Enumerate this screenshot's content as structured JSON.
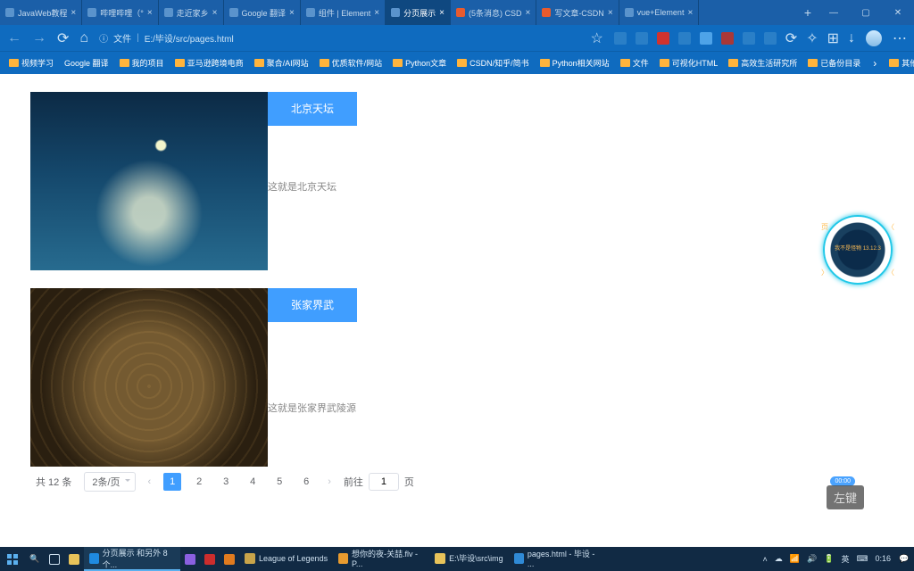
{
  "browser_tabs": [
    {
      "label": "JavaWeb教程"
    },
    {
      "label": "哔哩哔哩（°"
    },
    {
      "label": "走近家乡"
    },
    {
      "label": "Google 翻译"
    },
    {
      "label": "组件 | Element"
    },
    {
      "label": "分页展示"
    },
    {
      "label": "(5条消息) CSD"
    },
    {
      "label": "写文章-CSDN"
    },
    {
      "label": "vue+Element"
    }
  ],
  "active_tab_index": 5,
  "window_controls": {
    "min": "—",
    "max": "▢",
    "close": "✕"
  },
  "address": {
    "file_label": "文件",
    "path": "E:/毕设/src/pages.html"
  },
  "addr_icons": [
    "star",
    "ext1",
    "shield",
    "tri",
    "x",
    "n",
    "ia",
    "ext2",
    "ext3",
    "pin",
    "refresh",
    "reader",
    "download"
  ],
  "bookmarks": [
    "视频学习",
    "Google 翻译",
    "我的项目",
    "亚马逊跨境电商",
    "聚合/AI网站",
    "优质软件/网站",
    "Python文章",
    "CSDN/知乎/简书",
    "Python相关网站",
    "文件",
    "可视化HTML",
    "高效生活研究所",
    "已备份目录"
  ],
  "bookmark_overflow": {
    "more": "›",
    "other": "其他收藏夹"
  },
  "cards": [
    {
      "title": "北京天坛",
      "desc": "这就是北京天坛"
    },
    {
      "title": "张家界武陵源",
      "desc": "这就是张家界武陵源"
    }
  ],
  "pagination": {
    "total_label": "共 12 条",
    "page_size_label": "2条/页",
    "prev": "‹",
    "next": "›",
    "pages": [
      "1",
      "2",
      "3",
      "4",
      "5",
      "6"
    ],
    "active_page": "1",
    "goto_label": "前往",
    "goto_value": "1",
    "page_suffix": "页"
  },
  "floating_widget": {
    "inner": "我不是怪物\n13.12.3",
    "corners": [
      "页",
      "〈",
      "〉",
      "〈"
    ]
  },
  "mouse_label": "左键",
  "bubble": "00:00",
  "taskbar": {
    "apps": [
      {
        "label": "分页展示 和另外 8 个...",
        "color": "#1f8ae0",
        "active": true
      },
      {
        "label": "",
        "color": "#8a5fe0"
      },
      {
        "label": "",
        "color": "#cc2d2d"
      },
      {
        "label": "",
        "color": "#e07b1f"
      },
      {
        "label": "League of Legends",
        "color": "#c8a44a"
      },
      {
        "label": "想你的夜-关喆.flv - P...",
        "color": "#e89b2f"
      },
      {
        "label": "E:\\毕设\\src\\img",
        "color": "#e8c35a"
      },
      {
        "label": "pages.html - 毕设 - ...",
        "color": "#2f8ad6"
      }
    ],
    "ime": "英",
    "ime2": "⌨",
    "time": "0:16",
    "date": ""
  }
}
